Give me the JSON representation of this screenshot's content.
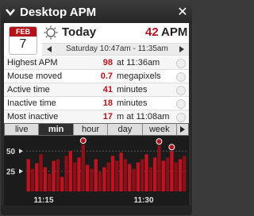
{
  "window": {
    "title": "Desktop APM"
  },
  "header": {
    "month": "FEB",
    "day": "7",
    "today_label": "Today",
    "apm_value": "42",
    "apm_unit": "APM"
  },
  "range": {
    "text": "Saturday 10:47am - 11:35am"
  },
  "stats": [
    {
      "label": "Highest APM",
      "value": "98",
      "unit": "at 11:36am"
    },
    {
      "label": "Mouse moved",
      "value": "0.7",
      "unit": "megapixels"
    },
    {
      "label": "Active time",
      "value": "41",
      "unit": "minutes"
    },
    {
      "label": "Inactive time",
      "value": "18",
      "unit": "minutes"
    },
    {
      "label": "Most inactive",
      "value": "17",
      "unit": "m at 11:08am"
    }
  ],
  "tabs": [
    "live",
    "min",
    "hour",
    "day",
    "week"
  ],
  "active_tab": "min",
  "colors": {
    "accent": "#b3141c",
    "chart_bar": "#c1121f",
    "chart_bg": "#1b1b1b"
  },
  "chart_data": {
    "type": "bar",
    "yticks": [
      "50",
      "25"
    ],
    "xticks": [
      "11:15",
      "11:30"
    ],
    "values": [
      40,
      28,
      35,
      46,
      30,
      22,
      38,
      40,
      18,
      44,
      50,
      36,
      42,
      58,
      33,
      28,
      40,
      24,
      30,
      36,
      44,
      38,
      48,
      40,
      34,
      28,
      36,
      40,
      46,
      30,
      42,
      57,
      38,
      42,
      50,
      36,
      40,
      44
    ],
    "markers": [
      13,
      31,
      34
    ],
    "ylim": [
      0,
      65
    ]
  }
}
